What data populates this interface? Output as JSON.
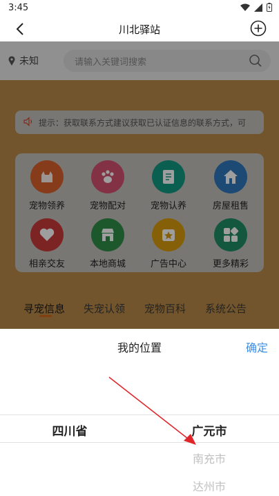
{
  "status_bar": {
    "time": "3:45"
  },
  "header": {
    "title": "川北驿站"
  },
  "search": {
    "location": "未知",
    "placeholder": "请输入关键词搜索"
  },
  "notice": {
    "text": "提示：获取联系方式建议获取已认证信息的联系方式，可"
  },
  "grid": {
    "items": [
      {
        "label": "宠物领养",
        "color": "#d9622b",
        "icon": "cat-icon"
      },
      {
        "label": "宠物配对",
        "color": "#d2516f",
        "icon": "paw-icon"
      },
      {
        "label": "宠物认养",
        "color": "#139a83",
        "icon": "document-icon"
      },
      {
        "label": "房屋租售",
        "color": "#2f77bd",
        "icon": "house-icon"
      },
      {
        "label": "相亲交友",
        "color": "#c93a3a",
        "icon": "heart-icon"
      },
      {
        "label": "本地商城",
        "color": "#2f8f48",
        "icon": "shop-icon"
      },
      {
        "label": "广告中心",
        "color": "#d79b10",
        "icon": "star-badge-icon"
      },
      {
        "label": "更多精彩",
        "color": "#1f8e65",
        "icon": "grid-more-icon"
      }
    ]
  },
  "tabs": [
    {
      "label": "寻宠信息",
      "active": true
    },
    {
      "label": "失宠认领",
      "active": false
    },
    {
      "label": "宠物百科",
      "active": false
    },
    {
      "label": "系统公告",
      "active": false
    }
  ],
  "sheet": {
    "title": "我的位置",
    "confirm": "确定",
    "province": {
      "selected": "四川省"
    },
    "city": {
      "selected": "广元市",
      "next": [
        "南充市",
        "达州市"
      ]
    }
  },
  "colors": {
    "accent": "#3a8ee6",
    "tab_indicator": "#d0661d",
    "annotation": "#e0262b"
  }
}
